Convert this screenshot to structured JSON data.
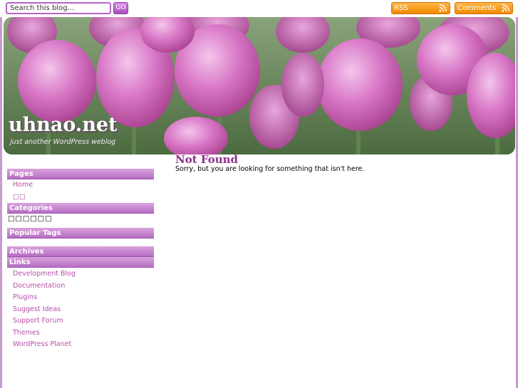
{
  "search": {
    "placeholder": "Search this blog...",
    "go_label": "GO"
  },
  "feeds": {
    "rss_label": "RSS",
    "comments_label": "Comments"
  },
  "header": {
    "title": "uhnao.net",
    "tagline": "just another WordPress weblog"
  },
  "sidebar": {
    "pages": {
      "title": "Pages",
      "items": [
        "Home",
        "□□"
      ]
    },
    "categories": {
      "title": "Categories",
      "text": "□□□□□□"
    },
    "popular_tags": {
      "title": "Popular Tags"
    },
    "archives": {
      "title": "Archives"
    },
    "links": {
      "title": "Links",
      "items": [
        "Development Blog",
        "Documentation",
        "Plugins",
        "Suggest Ideas",
        "Support Forum",
        "Themes",
        "WordPress Planet"
      ]
    }
  },
  "main": {
    "title": "Not Found",
    "text": "Sorry, but you are looking for something that isn't here."
  },
  "colors": {
    "accent": "#b565c8",
    "link": "#b84ea8",
    "feed": "#f08a00",
    "heading": "#8e2f8a"
  }
}
